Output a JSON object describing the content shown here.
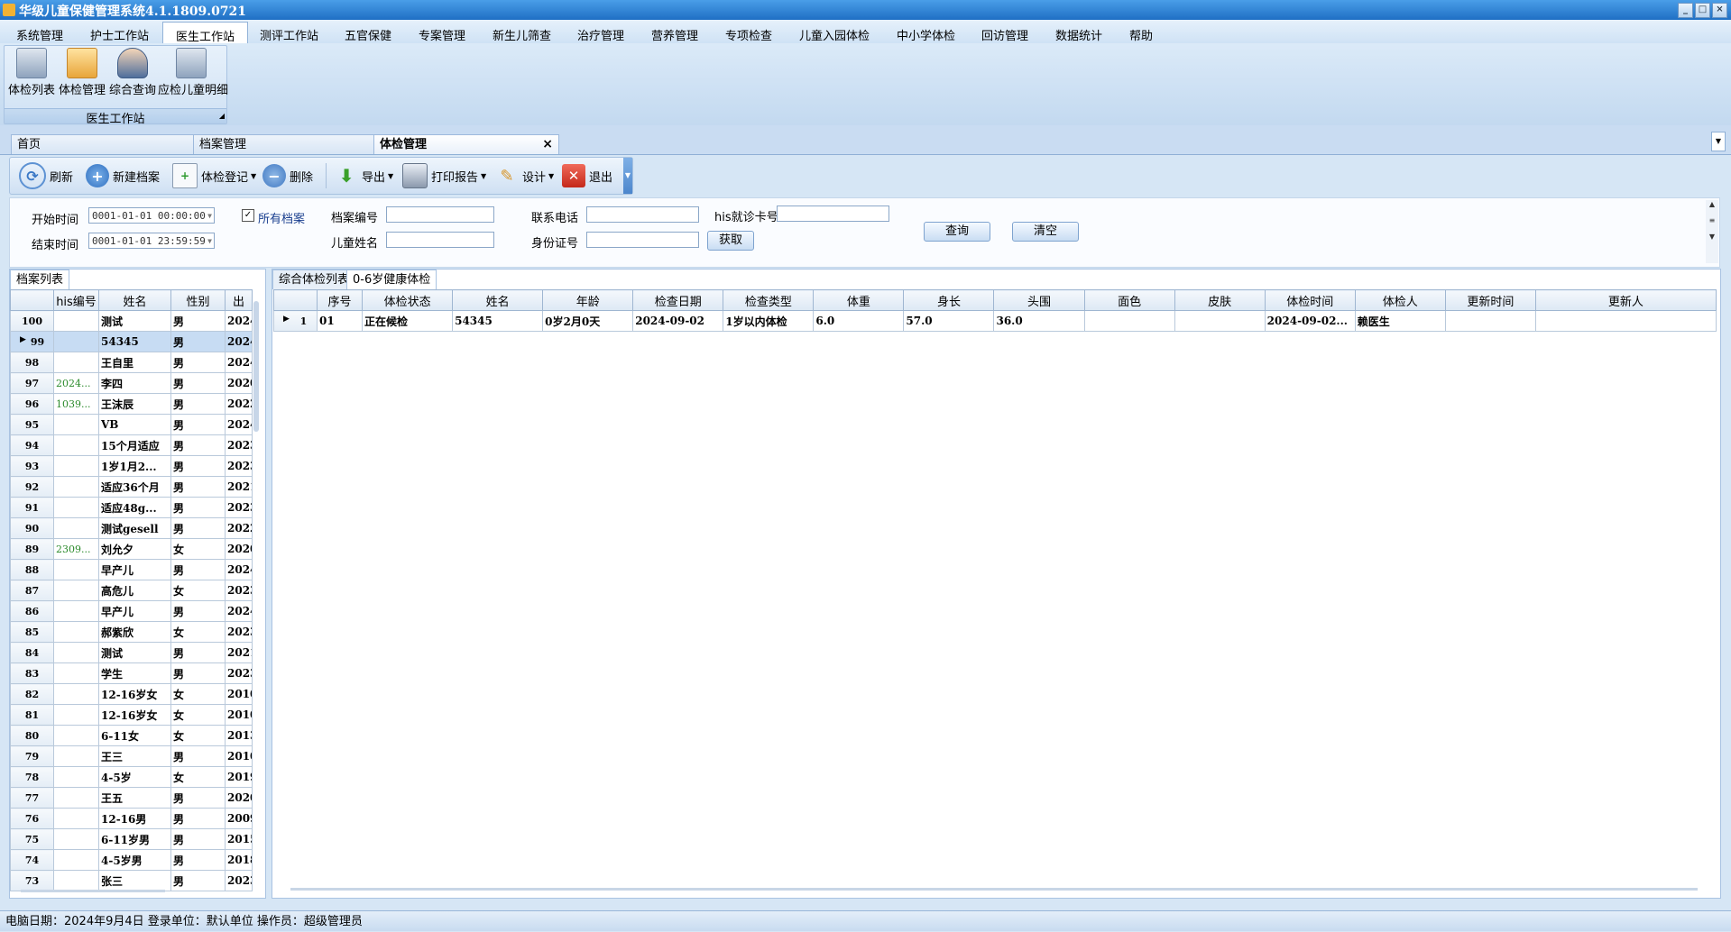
{
  "window": {
    "title": "华级儿童保健管理系统4.1.1809.0721",
    "min": "_",
    "max": "□",
    "close": "×"
  },
  "menu": [
    "系统管理",
    "护士工作站",
    "医生工作站",
    "测评工作站",
    "五官保健",
    "专案管理",
    "新生儿筛查",
    "治疗管理",
    "营养管理",
    "专项检查",
    "儿童入园体检",
    "中小学体检",
    "回访管理",
    "数据统计",
    "帮助"
  ],
  "ribbon": {
    "buttons": [
      "体检列表",
      "体检管理",
      "综合查询",
      "应检儿童明细"
    ],
    "group_label": "医生工作站"
  },
  "doc_tabs": [
    "首页",
    "档案管理",
    "体检管理"
  ],
  "toolbar": {
    "refresh": "刷新",
    "new": "新建档案",
    "register": "体检登记",
    "delete": "删除",
    "export": "导出",
    "print": "打印报告",
    "design": "设计",
    "exit": "退出"
  },
  "filter": {
    "start_label": "开始时间",
    "start_value": "0001-01-01 00:00:00",
    "end_label": "结束时间",
    "end_value": "0001-01-01 23:59:59",
    "all_files_label": "所有档案",
    "all_files_checked": "✓",
    "file_no_label": "档案编号",
    "child_name_label": "儿童姓名",
    "phone_label": "联系电话",
    "idcard_label": "身份证号",
    "his_card_label": "his就诊卡号",
    "fetch_button": "获取",
    "query_button": "查询",
    "clear_button": "清空"
  },
  "left_panel": {
    "tab": "档案列表",
    "columns": [
      "his编号",
      "姓名",
      "性别",
      "出"
    ],
    "rows": [
      {
        "no": "100",
        "his": "",
        "name": "测试",
        "sex": "男",
        "birth": "2024"
      },
      {
        "no": "99",
        "his": "",
        "name": "54345",
        "sex": "男",
        "birth": "2024"
      },
      {
        "no": "98",
        "his": "",
        "name": "王自里",
        "sex": "男",
        "birth": "2024"
      },
      {
        "no": "97",
        "his": "2024...",
        "name": "李四",
        "sex": "男",
        "birth": "2020"
      },
      {
        "no": "96",
        "his": "1039...",
        "name": "王沫辰",
        "sex": "男",
        "birth": "2022"
      },
      {
        "no": "95",
        "his": "",
        "name": "VB",
        "sex": "男",
        "birth": "2024"
      },
      {
        "no": "94",
        "his": "",
        "name": "15个月适应",
        "sex": "男",
        "birth": "2023"
      },
      {
        "no": "93",
        "his": "",
        "name": "1岁1月2...",
        "sex": "男",
        "birth": "2023"
      },
      {
        "no": "92",
        "his": "",
        "name": "适应36个月",
        "sex": "男",
        "birth": "2021"
      },
      {
        "no": "91",
        "his": "",
        "name": "适应48g...",
        "sex": "男",
        "birth": "2023"
      },
      {
        "no": "90",
        "his": "",
        "name": "测试gesell",
        "sex": "男",
        "birth": "2022"
      },
      {
        "no": "89",
        "his": "2309...",
        "name": "刘允夕",
        "sex": "女",
        "birth": "2020"
      },
      {
        "no": "88",
        "his": "",
        "name": "早产儿",
        "sex": "男",
        "birth": "2024"
      },
      {
        "no": "87",
        "his": "",
        "name": "高危儿",
        "sex": "女",
        "birth": "2023"
      },
      {
        "no": "86",
        "his": "",
        "name": "早产儿",
        "sex": "男",
        "birth": "2024"
      },
      {
        "no": "85",
        "his": "",
        "name": "郝紫欣",
        "sex": "女",
        "birth": "2023"
      },
      {
        "no": "84",
        "his": "",
        "name": "测试",
        "sex": "男",
        "birth": "2021"
      },
      {
        "no": "83",
        "his": "",
        "name": "学生",
        "sex": "男",
        "birth": "2023"
      },
      {
        "no": "82",
        "his": "",
        "name": "12-16岁女",
        "sex": "女",
        "birth": "2010"
      },
      {
        "no": "81",
        "his": "",
        "name": "12-16岁女",
        "sex": "女",
        "birth": "2010"
      },
      {
        "no": "80",
        "his": "",
        "name": "6-11女",
        "sex": "女",
        "birth": "2013"
      },
      {
        "no": "79",
        "his": "",
        "name": "王三",
        "sex": "男",
        "birth": "2010"
      },
      {
        "no": "78",
        "his": "",
        "name": "4-5岁",
        "sex": "女",
        "birth": "2019"
      },
      {
        "no": "77",
        "his": "",
        "name": "王五",
        "sex": "男",
        "birth": "2020"
      },
      {
        "no": "76",
        "his": "",
        "name": "12-16男",
        "sex": "男",
        "birth": "2009"
      },
      {
        "no": "75",
        "his": "",
        "name": "6-11岁男",
        "sex": "男",
        "birth": "2015"
      },
      {
        "no": "74",
        "his": "",
        "name": "4-5岁男",
        "sex": "男",
        "birth": "2018"
      },
      {
        "no": "73",
        "his": "",
        "name": "张三",
        "sex": "男",
        "birth": "2023"
      }
    ]
  },
  "right_panel": {
    "tabs": [
      "综合体检列表",
      "0-6岁健康体检"
    ],
    "columns": [
      "序号",
      "体检状态",
      "姓名",
      "年龄",
      "检查日期",
      "检查类型",
      "体重",
      "身长",
      "头围",
      "面色",
      "皮肤",
      "体检时间",
      "体检人",
      "更新时间",
      "更新人"
    ],
    "rows": [
      {
        "rownum": "1",
        "cells": [
          "01",
          "正在候检",
          "54345",
          "0岁2月0天",
          "2024-09-02",
          "1岁以内体检",
          "6.0",
          "57.0",
          "36.0",
          "",
          "",
          "2024-09-02...",
          "赖医生",
          "",
          ""
        ]
      }
    ]
  },
  "status": "电脑日期：2024年9月4日  登录单位：默认单位  操作员：超级管理员"
}
